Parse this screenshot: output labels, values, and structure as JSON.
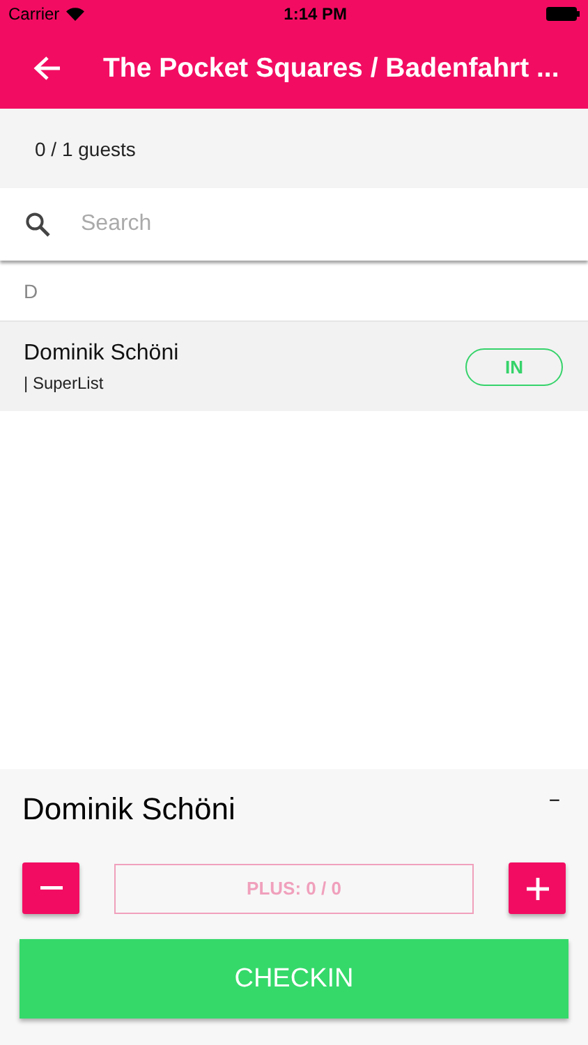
{
  "status_bar": {
    "carrier": "Carrier",
    "time": "1:14 PM"
  },
  "header": {
    "title": "The Pocket Squares / Badenfahrt ..."
  },
  "summary": "0 / 1 guests",
  "search": {
    "placeholder": "Search"
  },
  "sections": [
    {
      "letter": "D",
      "guests": [
        {
          "name": "Dominik Schöni",
          "list": "| SuperList",
          "status": "IN"
        }
      ]
    }
  ],
  "panel": {
    "name": "Dominik Schöni",
    "collapse": "−",
    "plus_label": "PLUS: 0 / 0",
    "action": "CHECKIN"
  }
}
